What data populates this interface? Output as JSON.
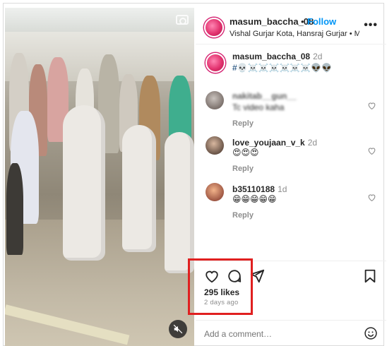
{
  "post": {
    "username": "masum_baccha_08",
    "separator": "•",
    "follow_label": "Follow",
    "location": "Vishal Gurjar Kota, Hansraj Gurjar • Milb",
    "more_label": "•••"
  },
  "caption": {
    "username": "masum_baccha_08",
    "time": "2d",
    "text": "#💀☠️☠️☠️☠️☠️☠️👽👽"
  },
  "comments": [
    {
      "username": "nakitab__gun__",
      "time": "",
      "text": "Tc video kaha",
      "reply_label": "Reply"
    },
    {
      "username": "love_youjaan_v_k",
      "time": "2d",
      "text": "😍😍😍",
      "reply_label": "Reply"
    },
    {
      "username": "b35110188",
      "time": "1d",
      "text": "😁😁😁😁😁",
      "reply_label": "Reply"
    }
  ],
  "engagement": {
    "likes": "295 likes",
    "time_ago": "2 days ago"
  },
  "add_comment": {
    "placeholder": "Add a comment…"
  },
  "icons": {
    "like": "heart-icon",
    "comment": "comment-bubble-icon",
    "share": "paper-plane-icon",
    "save": "bookmark-icon",
    "emoji": "emoji-smile-icon",
    "mute": "speaker-muted-icon",
    "camera": "camera-icon"
  },
  "colors": {
    "accent": "#0095f6",
    "highlight": "#e02020",
    "text": "#262626",
    "muted": "#8e8e8e"
  }
}
